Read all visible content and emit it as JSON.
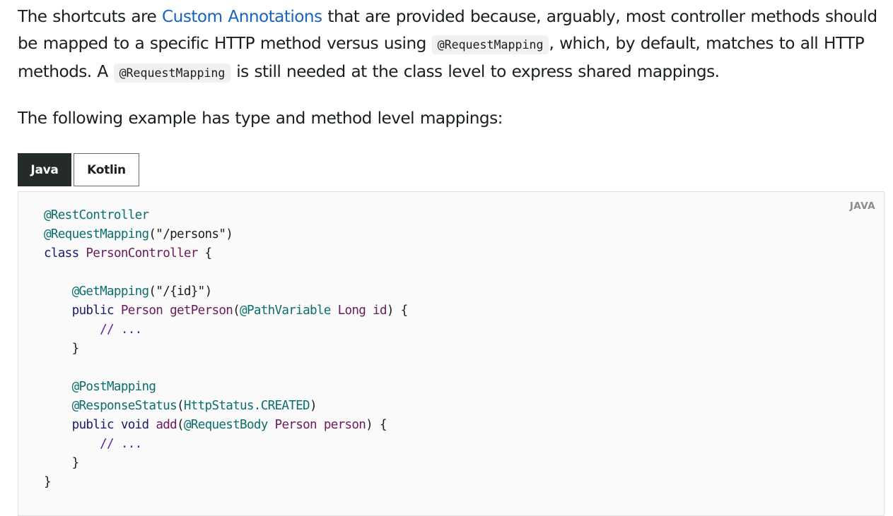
{
  "paragraph1": {
    "text_before_link": "The shortcuts are ",
    "link_text": "Custom Annotations",
    "text_after_link": " that are provided because, arguably, most controller methods should be mapped to a specific HTTP method versus using ",
    "code1": "@RequestMapping",
    "text_after_code1": ", which, by default, matches to all HTTP methods. A ",
    "code2": "@RequestMapping",
    "text_after_code2": " is still needed at the class level to express shared mappings."
  },
  "paragraph2": "The following example has type and method level mappings:",
  "tabs": {
    "java_label": "Java",
    "kotlin_label": "Kotlin",
    "active": "Java"
  },
  "code_block": {
    "language_label": "JAVA",
    "lines": [
      "@RestController",
      "@RequestMapping(\"/persons\")",
      "class PersonController {",
      "",
      "    @GetMapping(\"/{id}\")",
      "    public Person getPerson(@PathVariable Long id) {",
      "        // ...",
      "    }",
      "",
      "    @PostMapping",
      "    @ResponseStatus(HttpStatus.CREATED)",
      "    public void add(@RequestBody Person person) {",
      "        // ...",
      "    }",
      "}"
    ]
  },
  "colors": {
    "link": "#1565c0",
    "active_tab_bg": "#252a2b",
    "code_bg": "#fafafa",
    "annotation": "#0c6e6e",
    "keyword": "#1a1a6e",
    "type": "#6a1b5a"
  }
}
